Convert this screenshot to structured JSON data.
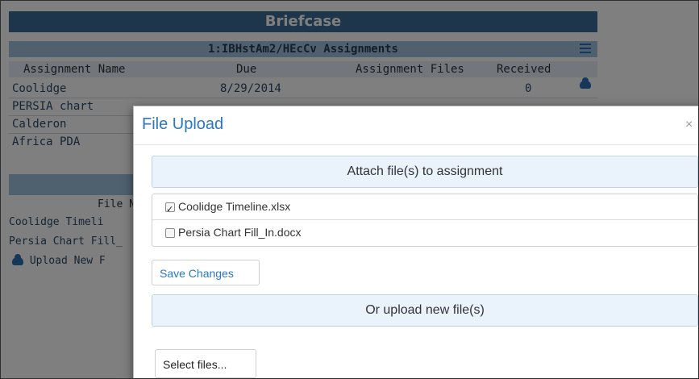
{
  "briefcase": {
    "title": "Briefcase",
    "subtitle": "1:IBHstAm2/HEcCv Assignments",
    "columns": [
      "Assignment Name",
      "Due",
      "Assignment Files",
      "Received"
    ],
    "rows": [
      {
        "name": "Coolidge",
        "due": "8/29/2014",
        "received": "0"
      },
      {
        "name": "PERSIA chart",
        "due": "",
        "received": ""
      },
      {
        "name": "Calderon",
        "due": "",
        "received": ""
      },
      {
        "name": "Africa PDA",
        "due": "",
        "received": ""
      }
    ],
    "files_header": "File Na",
    "files": [
      "Coolidge Timeli",
      "Persia Chart Fill_",
      "Upload New F"
    ]
  },
  "modal": {
    "title": "File Upload",
    "close": "×",
    "attach_header": "Attach file(s) to assignment",
    "files": [
      {
        "label": "Coolidge Timeline.xlsx",
        "checked": true
      },
      {
        "label": "Persia Chart Fill_In.docx",
        "checked": false
      }
    ],
    "save_label": "Save Changes",
    "upload_header": "Or upload new file(s)",
    "select_label": "Select files..."
  },
  "colors": {
    "title_bar": "#3d6c96",
    "sub_bar": "#9fc1df",
    "accent": "#2a78c4"
  }
}
